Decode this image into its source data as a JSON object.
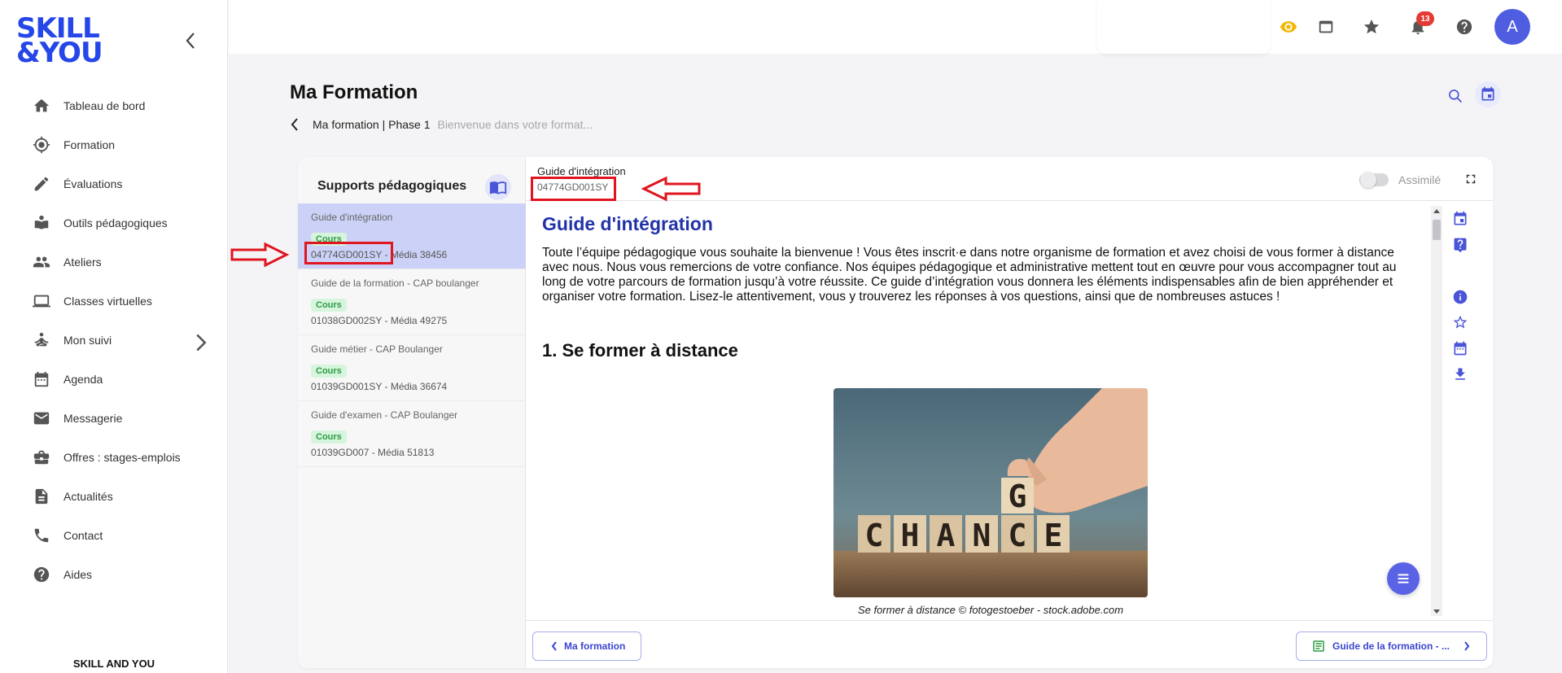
{
  "brand": {
    "logo_line1": "SKILL",
    "logo_line2": "&YOU",
    "footer": "SKILL AND YOU"
  },
  "nav": [
    {
      "label": "Tableau de bord",
      "icon": "home-icon"
    },
    {
      "label": "Formation",
      "icon": "target-icon"
    },
    {
      "label": "Évaluations",
      "icon": "pencil-icon"
    },
    {
      "label": "Outils pédagogiques",
      "icon": "reading-icon"
    },
    {
      "label": "Ateliers",
      "icon": "group-icon"
    },
    {
      "label": "Classes virtuelles",
      "icon": "laptop-icon"
    },
    {
      "label": "Mon suivi",
      "icon": "person-meditation-icon"
    },
    {
      "label": "Agenda",
      "icon": "calendar-icon"
    },
    {
      "label": "Messagerie",
      "icon": "mail-icon"
    },
    {
      "label": "Offres : stages-emplois",
      "icon": "briefcase-icon"
    },
    {
      "label": "Actualités",
      "icon": "article-icon"
    },
    {
      "label": "Contact",
      "icon": "phone-icon"
    },
    {
      "label": "Aides",
      "icon": "help-circle-icon"
    }
  ],
  "topbar": {
    "notification_count": "13",
    "avatar_letter": "A"
  },
  "page": {
    "title": "Ma Formation",
    "breadcrumb": "Ma formation | Phase 1",
    "breadcrumb_sub": "Bienvenue dans votre format..."
  },
  "supports": {
    "title": "Supports pédagogiques",
    "items": [
      {
        "title": "Guide d'intégration",
        "tag": "Cours",
        "meta": "04774GD001SY - Média 38456"
      },
      {
        "title": "Guide de la formation - CAP boulanger",
        "tag": "Cours",
        "meta": "01038GD002SY - Média 49275"
      },
      {
        "title": "Guide métier - CAP Boulanger",
        "tag": "Cours",
        "meta": "01039GD001SY - Média 36674"
      },
      {
        "title": "Guide d'examen - CAP Boulanger",
        "tag": "Cours",
        "meta": "01039GD007 - Média 51813"
      }
    ]
  },
  "viewer": {
    "doc_title": "Guide d'intégration",
    "doc_code": "04774GD001SY",
    "assimile_label": "Assimilé",
    "heading": "Guide d'intégration",
    "intro": "Toute l’équipe pédagogique vous souhaite la bienvenue ! Vous êtes inscrit·e dans notre organisme de formation et avez choisi de vous former à distance avec nous. Nous vous remercions de votre confiance. Nos équipes pédagogique et administrative mettent tout en œuvre pour vous accompagner tout au long de votre parcours de formation jusqu’à votre réussite. Ce guide d’intégration vous donnera les éléments indispensables afin de bien appréhender et organiser votre formation. Lisez-le attentivement, vous y trouverez les réponses à vos questions, ainsi que de nombreuses astuces !",
    "section1": "1. Se former à distance",
    "image_letters": [
      "C",
      "H",
      "A",
      "N",
      "C",
      "E",
      "G"
    ],
    "caption": "Se former à distance © fotogestoeber - stock.adobe.com",
    "prev_label": "Ma formation",
    "next_label": "Guide de la formation - ..."
  },
  "colors": {
    "accent": "#4f5de0",
    "logo": "#2546e8",
    "active_item": "#ccd2f7",
    "tag_bg": "#d6f5dc",
    "tag_text": "#2e9b47",
    "annotation": "#e0151f"
  }
}
